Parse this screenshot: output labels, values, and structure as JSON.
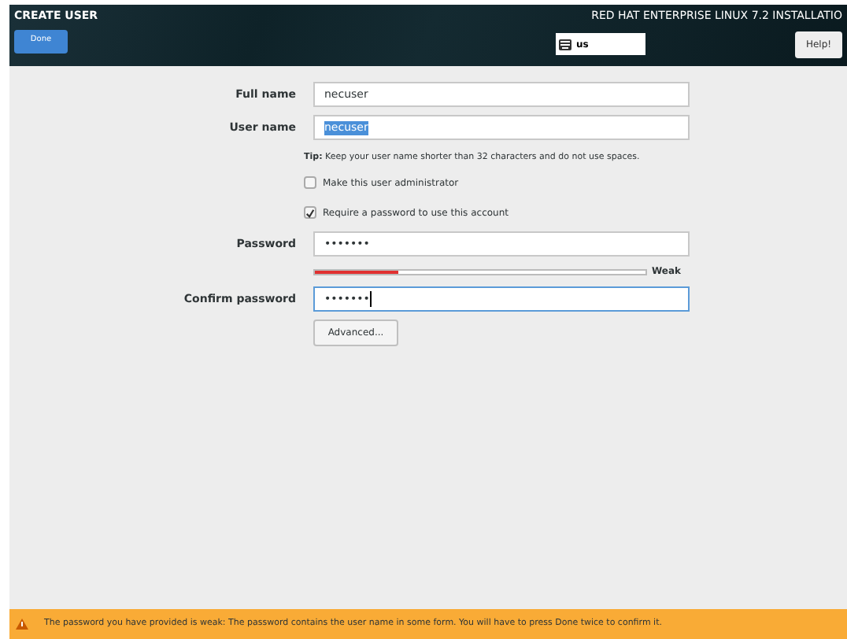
{
  "header": {
    "title": "CREATE USER",
    "done_button": "Done",
    "product": "RED HAT ENTERPRISE LINUX 7.2 INSTALLATIO",
    "keyboard_layout": "us",
    "help_button": "Help!"
  },
  "form": {
    "full_name": {
      "label": "Full name",
      "value": "necuser"
    },
    "user_name": {
      "label": "User name",
      "value": "necuser",
      "selected": true
    },
    "tip": "**Tip:** Keep your user name shorter than 32 characters and do not use spaces.",
    "checkboxes": [
      {
        "label": "Make this user administrator",
        "checked": false
      },
      {
        "label": "Require a password to use this account",
        "checked": true
      }
    ],
    "password": {
      "label": "Password",
      "value": "•••••••"
    },
    "strength": {
      "level": 0.25,
      "reading": "Weak"
    },
    "confirm_password": {
      "label": "Confirm password",
      "value": "•••••••",
      "focused": true
    },
    "advanced_button": "Advanced..."
  },
  "status_bar": {
    "message": "The password you have provided is weak: The password contains the user name in some form. You will have to press Done twice to confirm it."
  }
}
